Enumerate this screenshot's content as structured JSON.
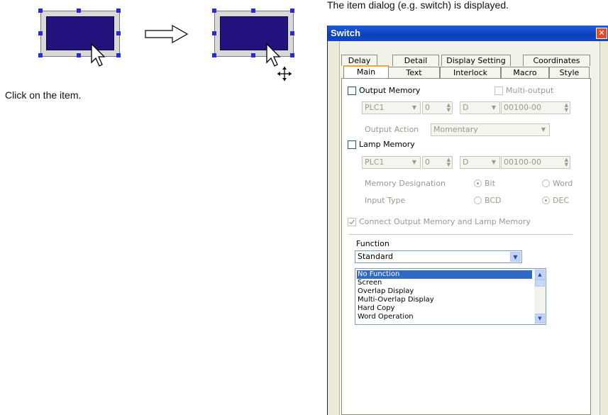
{
  "left": {
    "caption": "Click on the item."
  },
  "right": {
    "caption": "The item dialog (e.g. switch) is displayed."
  },
  "dialog": {
    "title": "Switch",
    "close_glyph": "✕",
    "tabs_row1": [
      "Delay",
      "Detail",
      "Display Setting",
      "Coordinates"
    ],
    "tabs_row2": [
      "Main",
      "Text",
      "Interlock",
      "Macro",
      "Style"
    ],
    "output_memory": {
      "label": "Output Memory",
      "multi_output_label": "Multi-output",
      "plc": "PLC1",
      "num": "0",
      "device": "D",
      "address": "00100-00",
      "action_label": "Output Action",
      "action_value": "Momentary"
    },
    "lamp_memory": {
      "label": "Lamp Memory",
      "plc": "PLC1",
      "num": "0",
      "device": "D",
      "address": "00100-00",
      "designation_label": "Memory Designation",
      "opt_bit": "Bit",
      "opt_word": "Word",
      "input_type_label": "Input Type",
      "opt_bcd": "BCD",
      "opt_dec": "DEC"
    },
    "connect_label": "Connect Output Memory and Lamp Memory",
    "function": {
      "label": "Function",
      "selected": "Standard",
      "items": [
        "No Function",
        "Screen",
        "Overlap Display",
        "Multi-Overlap Display",
        "Hard Copy",
        "Word Operation"
      ]
    }
  },
  "colors": {
    "item_fill": "#23127d",
    "handle": "#2b2bd6",
    "titlebar": "#0a3fb8",
    "tab_highlight": "#f0a23c",
    "selection": "#316ac5"
  }
}
